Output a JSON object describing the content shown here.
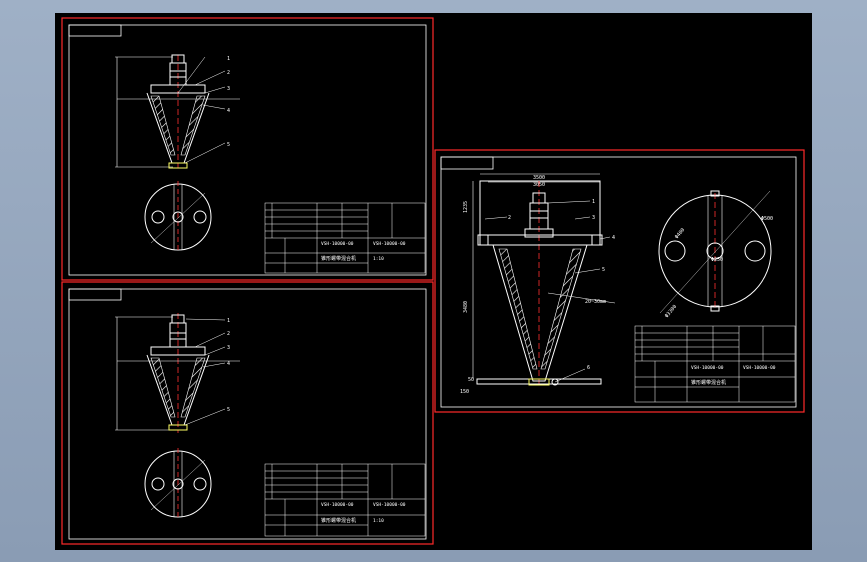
{
  "colors": {
    "background": "#8fa0b8",
    "canvas": "#000000",
    "sheet_border": "#ff2a2a",
    "linework": "#ffffff",
    "centerline": "#ff3030",
    "accent": "#ffff66"
  },
  "sheet_top_left": {
    "title_code_1": "VSH-10000-00",
    "title_code_2": "VSH-10000-00",
    "title_name": "锥形螺带混合机",
    "scale": "1:10",
    "balloons": [
      "1",
      "2",
      "3",
      "4",
      "5"
    ]
  },
  "sheet_bottom_left": {
    "title_code_1": "VSH-10000-00",
    "title_code_2": "VSH-10000-00",
    "title_name": "锥形螺带混合机",
    "scale": "1:10",
    "balloons": [
      "1",
      "2",
      "3",
      "4",
      "5"
    ]
  },
  "sheet_right": {
    "dimensions": {
      "overall_width": "3500",
      "inner_width": "3050",
      "top_height": "1235",
      "cone_height": "3480",
      "bottom_offset": "50",
      "bottom_width": "150",
      "ribbon_gap": "20~30mm",
      "plan_dia": "Φ3300",
      "plan_hole_1": "Φ500",
      "plan_hole_2": "Φ400",
      "plan_center": "Φ250"
    },
    "title_code_1": "VSH-10000-00",
    "title_code_2": "VSH-10000-00",
    "title_name": "锥形螺带混合机",
    "balloons": [
      "1",
      "2",
      "3",
      "4",
      "5",
      "6"
    ]
  }
}
